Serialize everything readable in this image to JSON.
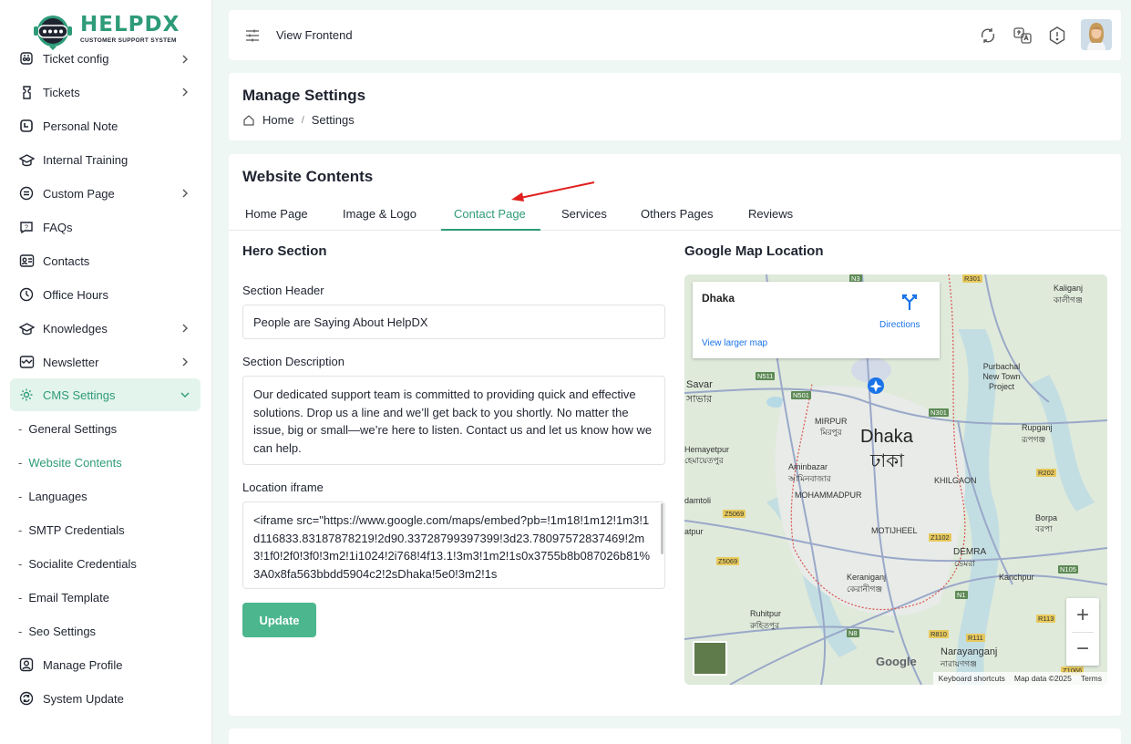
{
  "brand": {
    "name": "HELPDX",
    "tagline": "CUSTOMER SUPPORT SYSTEM",
    "accent": "#2e9b78"
  },
  "sidebar": {
    "items": [
      {
        "label": "Ticket config",
        "icon": "ticket-config-icon",
        "has_children": true
      },
      {
        "label": "Tickets",
        "icon": "ticket-icon",
        "has_children": true
      },
      {
        "label": "Personal Note",
        "icon": "note-icon",
        "has_children": false
      },
      {
        "label": "Internal Training",
        "icon": "training-icon",
        "has_children": false
      },
      {
        "label": "Custom Page",
        "icon": "page-icon",
        "has_children": true
      },
      {
        "label": "FAQs",
        "icon": "faq-icon",
        "has_children": false
      },
      {
        "label": "Contacts",
        "icon": "contacts-icon",
        "has_children": false
      },
      {
        "label": "Office Hours",
        "icon": "clock-icon",
        "has_children": false
      },
      {
        "label": "Knowledges",
        "icon": "knowledge-icon",
        "has_children": true
      },
      {
        "label": "Newsletter",
        "icon": "newsletter-icon",
        "has_children": true
      },
      {
        "label": "CMS Settings",
        "icon": "gear-icon",
        "has_children": true,
        "expanded": true
      }
    ],
    "cms_sub": [
      {
        "label": "General Settings"
      },
      {
        "label": "Website Contents",
        "active": true
      },
      {
        "label": "Languages"
      },
      {
        "label": "SMTP Credentials"
      },
      {
        "label": "Socialite Credentials"
      },
      {
        "label": "Email Template"
      },
      {
        "label": "Seo Settings"
      }
    ],
    "bottom": [
      {
        "label": "Manage Profile",
        "icon": "user-icon"
      },
      {
        "label": "System Update",
        "icon": "refresh-icon"
      }
    ]
  },
  "topbar": {
    "view_frontend": "View Frontend"
  },
  "manage": {
    "title": "Manage Settings",
    "crumb_home": "Home",
    "crumb_sep": "/",
    "crumb_current": "Settings"
  },
  "content": {
    "title": "Website Contents",
    "tabs": [
      "Home Page",
      "Image & Logo",
      "Contact Page",
      "Services",
      "Others Pages",
      "Reviews"
    ],
    "active_tab": "Contact Page",
    "hero_title": "Hero Section",
    "header_label": "Section Header",
    "header_value": "People are Saying About HelpDX",
    "desc_label": "Section Description",
    "desc_value": "Our dedicated support team is committed to providing quick and effective solutions. Drop us a line and we’ll get back to you shortly. No matter the issue, big or small—we’re here to listen. Contact us and let us know how we can help.",
    "iframe_label": "Location iframe",
    "iframe_value": "<iframe src=\"https://www.google.com/maps/embed?pb=!1m18!1m12!1m3!1d116833.83187878219!2d90.33728799397399!3d23.78097572837469!2m3!1f0!2f0!3f0!3m2!1i1024!2i768!4f13.1!3m3!1m2!1s0x3755b8b087026b81%3A0x8fa563bbdd5904c2!2sDhaka!5e0!3m2!1s",
    "update_label": "Update",
    "map_title": "Google Map Location"
  },
  "map": {
    "place": "Dhaka",
    "directions": "Directions",
    "view_larger": "View larger map",
    "city": "Dhaka",
    "city_bn": "ঢাকা",
    "footer_shortcuts": "Keyboard shortcuts",
    "footer_data": "Map data ©2025",
    "footer_terms": "Terms",
    "google": "Google",
    "labels": [
      "Savar",
      "সাভার",
      "MIRPUR",
      "মিরপুর",
      "Aminbazar",
      "আমিনবাজার",
      "MOHAMMADPUR",
      "KHILGAON",
      "MOTIJHEEL",
      "DEMRA",
      "ডেমরা",
      "Keraniganj",
      "কেরানীগঞ্জ",
      "Ruhitpur",
      "রুহিতপুর",
      "Narayanganj",
      "নারায়ণগঞ্জ",
      "Purbachal New Town Project",
      "Rupganj",
      "রূপগঞ্জ",
      "Kaliganj",
      "কালীগঞ্জ",
      "Borpa",
      "বরপা",
      "Kanchpur",
      "Hemayetpur",
      "হেমায়েতপুর",
      "damtoli",
      "atpur"
    ],
    "roads": [
      "N3",
      "R301",
      "N511",
      "N501",
      "N301",
      "Z5069",
      "R202",
      "Z1102",
      "N1",
      "N105",
      "R113",
      "R810",
      "R111",
      "N8",
      "Z5069",
      "Z1066"
    ],
    "zoom_in": "+",
    "zoom_out": "−"
  }
}
